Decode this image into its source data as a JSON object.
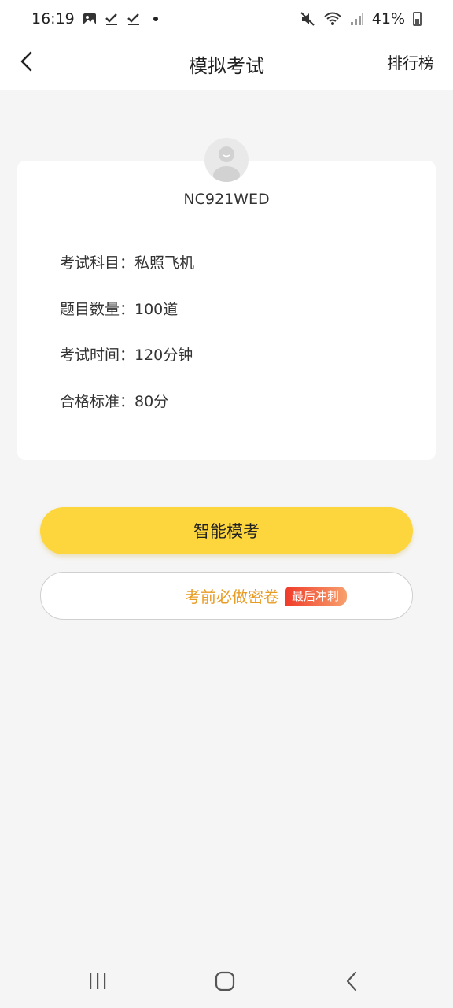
{
  "status_bar": {
    "time": "16:19",
    "battery": "41%",
    "icons": [
      "image-icon",
      "check-icon",
      "check-icon",
      "dot-icon",
      "mute-icon",
      "wifi-icon",
      "signal-icon",
      "battery-icon"
    ]
  },
  "header": {
    "title": "模拟考试",
    "right_link": "排行榜"
  },
  "profile": {
    "username": "NC921WED"
  },
  "exam_info": [
    "考试科目：私照飞机",
    "题目数量：100道",
    "考试时间：120分钟",
    "合格标准：80分"
  ],
  "actions": {
    "primary_label": "智能模考",
    "secondary_label": "考前必做密卷",
    "secondary_badge": "最后冲刺"
  },
  "colors": {
    "primary": "#fdd53d",
    "secondary_text": "#e89c24",
    "badge_start": "#ef3c2a",
    "badge_end": "#f7a06c",
    "background": "#f5f5f5"
  }
}
